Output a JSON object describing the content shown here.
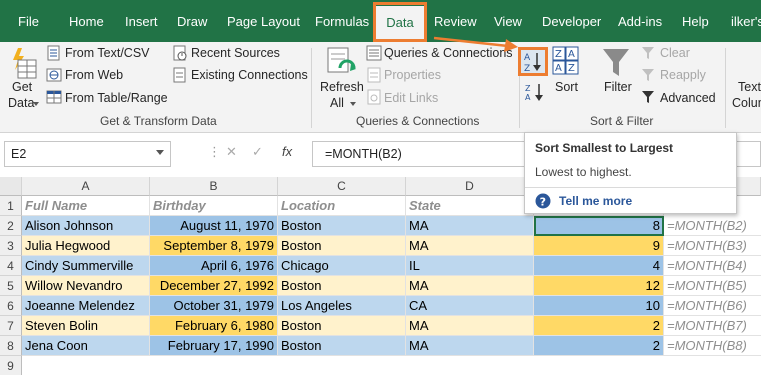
{
  "ribbon_tabs": [
    "File",
    "Home",
    "Insert",
    "Draw",
    "Page Layout",
    "Formulas",
    "Data",
    "Review",
    "View",
    "Developer",
    "Add-ins",
    "Help",
    "ilker's"
  ],
  "active_tab": "Data",
  "colors": {
    "accent_green": "#217346",
    "highlight_orange": "#ed7d31",
    "row_blue": "#bdd7ee",
    "row_yellow": "#fff2cc",
    "birthday_blue": "#9dc3e6",
    "birthday_gold": "#ffd966"
  },
  "groups": {
    "get_transform": {
      "label": "Get & Transform Data",
      "get_data": [
        "Get",
        "Data"
      ],
      "from_text_csv": "From Text/CSV",
      "from_web": "From Web",
      "from_table_range": "From Table/Range",
      "recent_sources": "Recent Sources",
      "existing_connections": "Existing Connections"
    },
    "queries": {
      "label": "Queries & Connections",
      "refresh_all": [
        "Refresh",
        "All"
      ],
      "queries_connections": "Queries & Connections",
      "properties": "Properties",
      "edit_links": "Edit Links"
    },
    "sort_filter": {
      "label": "Sort & Filter",
      "sort": "Sort",
      "filter": "Filter",
      "clear": "Clear",
      "reapply": "Reapply",
      "advanced": "Advanced"
    },
    "text_columns": [
      "Text",
      "Colum"
    ]
  },
  "formula_bar": {
    "name_box": "E2",
    "fx": "fx",
    "formula": "=MONTH(B2)"
  },
  "tooltip": {
    "title": "Sort Smallest to Largest",
    "description": "Lowest to highest.",
    "more": "Tell me more"
  },
  "sheet": {
    "columns": [
      "A",
      "B",
      "C",
      "D"
    ],
    "row_numbers": [
      "1",
      "2",
      "3",
      "4",
      "5",
      "6",
      "7",
      "8",
      "9"
    ],
    "header": {
      "name": "Full Name",
      "birthday": "Birthday",
      "location": "Location",
      "state": "State"
    },
    "rows": [
      {
        "name": "Alison Johnson",
        "birthday": "August 11, 1970",
        "location": "Boston",
        "state": "MA",
        "month": "8",
        "note": "=MONTH(B2)",
        "band": "blue"
      },
      {
        "name": "Julia  Hegwood",
        "birthday": "September 8, 1979",
        "location": "Boston",
        "state": "MA",
        "month": "9",
        "note": "=MONTH(B3)",
        "band": "yellow"
      },
      {
        "name": "Cindy Summerville",
        "birthday": "April 6, 1976",
        "location": "Chicago",
        "state": "IL",
        "month": "4",
        "note": "=MONTH(B4)",
        "band": "blue"
      },
      {
        "name": "Willow Nevandro",
        "birthday": "December 27, 1992",
        "location": "Boston",
        "state": "MA",
        "month": "12",
        "note": "=MONTH(B5)",
        "band": "yellow"
      },
      {
        "name": "Joeanne Melendez",
        "birthday": "October 31, 1979",
        "location": "Los Angeles",
        "state": "CA",
        "month": "10",
        "note": "=MONTH(B6)",
        "band": "blue"
      },
      {
        "name": "Steven  Bolin",
        "birthday": "February 6, 1980",
        "location": "Boston",
        "state": "MA",
        "month": "2",
        "note": "=MONTH(B7)",
        "band": "yellow"
      },
      {
        "name": "Jena Coon",
        "birthday": "February 17, 1990",
        "location": "Boston",
        "state": "MA",
        "month": "2",
        "note": "=MONTH(B8)",
        "band": "blue"
      }
    ]
  }
}
